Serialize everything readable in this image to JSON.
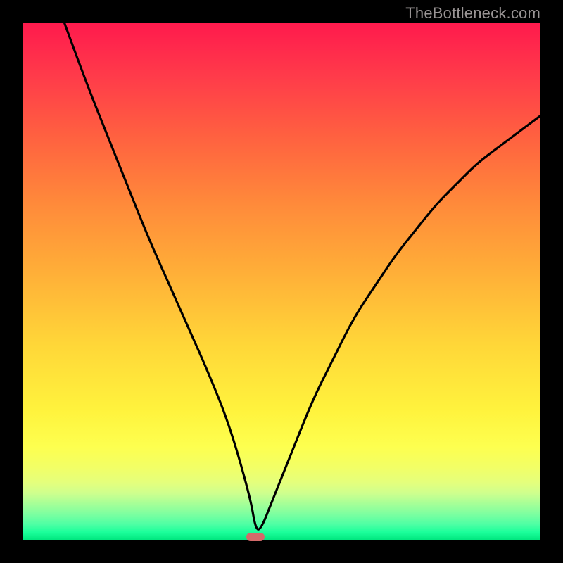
{
  "watermark": "TheBottleneck.com",
  "chart_data": {
    "type": "line",
    "title": "",
    "xlabel": "",
    "ylabel": "",
    "xlim": [
      0,
      100
    ],
    "ylim": [
      0,
      100
    ],
    "grid": false,
    "legend": false,
    "series": [
      {
        "name": "bottleneck-curve",
        "x": [
          8,
          12,
          16,
          20,
          24,
          28,
          32,
          36,
          40,
          44,
          45,
          46,
          48,
          52,
          56,
          60,
          64,
          68,
          72,
          76,
          80,
          84,
          88,
          92,
          96,
          100
        ],
        "values": [
          100,
          89,
          79,
          69,
          59,
          50,
          41,
          32,
          22,
          8,
          2,
          2,
          7,
          17,
          27,
          35,
          43,
          49,
          55,
          60,
          65,
          69,
          73,
          76,
          79,
          82
        ]
      }
    ],
    "annotations": [
      {
        "name": "min-marker",
        "x": 45,
        "y": 0.5,
        "shape": "rounded-rect",
        "color": "#d46a6a"
      }
    ],
    "background_gradient": {
      "direction": "vertical",
      "stops": [
        {
          "pos": 0.0,
          "color": "#ff1a4d"
        },
        {
          "pos": 0.5,
          "color": "#ffc038"
        },
        {
          "pos": 0.8,
          "color": "#fdff4f"
        },
        {
          "pos": 1.0,
          "color": "#00e77f"
        }
      ]
    }
  }
}
